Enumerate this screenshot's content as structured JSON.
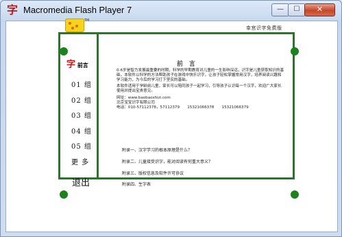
{
  "window": {
    "title": "Macromedia Flash Player 7",
    "app_icon": "字",
    "min_glyph": "—",
    "max_glyph": "☐",
    "close_glyph": "✕"
  },
  "header": {
    "right_text": "幸宫识字免费版"
  },
  "menu": {
    "icon": "字",
    "title": "前言",
    "items": [
      "01 组",
      "02 组",
      "03 组",
      "04 组",
      "05 组",
      "更 多"
    ],
    "exit": "退出"
  },
  "article": {
    "title": "前 言",
    "paragraph1": "0-6岁是智力发展最重要的时期，科学的早期教育对儿童的一生影响深远，识字是儿童获取知识的基础，本软件以科学的方法帮助孩子在游戏中快乐识字，让孩子轻松掌握常用汉字，培养阅读兴趣和学习能力，为今后的学习打下坚实的基础。",
    "paragraph2": "本软件适用于学龄前儿童，家长可以陪同孩子一起学习，引导孩子认识每一个汉字，欢迎广大家长使用并提出宝贵意见。",
    "website": "网址：www.baobaoshizi.com",
    "company": "北京宝宝识字有限公司",
    "phone": "电话：010-57112378，57112379　　15321066378　　15321066379"
  },
  "appendix": [
    "附录一、汉字学习的根本原理是什么？",
    "附录二、儿童接受识字，能对阅读有何重大意义？",
    "附录三、版权信息及软件许可协议",
    "附录四、生字表"
  ],
  "colors": {
    "frame_green": "#1f7c1f",
    "accent_red": "#c0181c",
    "logo_yellow": "#f7d31e"
  }
}
